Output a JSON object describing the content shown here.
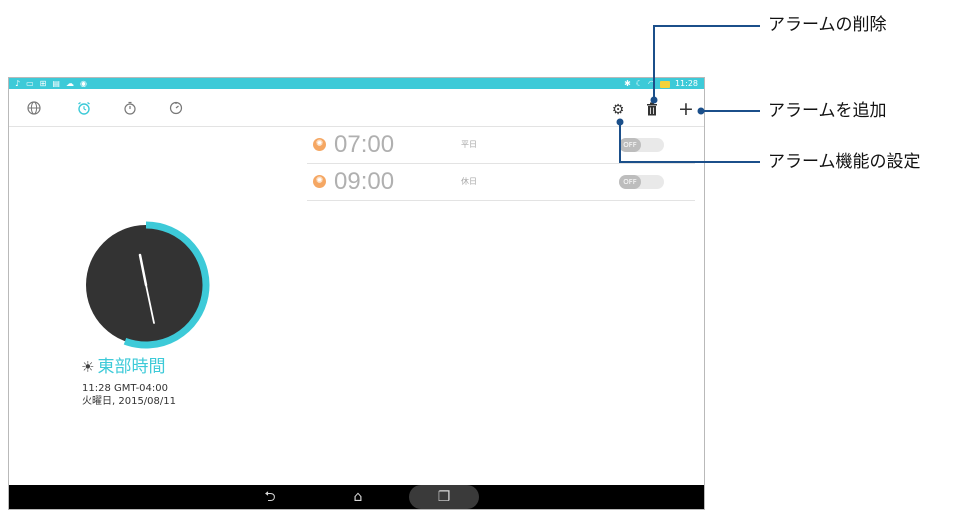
{
  "status_bar": {
    "left_icons": [
      "♪",
      "▭",
      "⊞",
      "▤",
      "☁",
      "◉"
    ],
    "right_icons": [
      "✱",
      "☾",
      "◠"
    ],
    "time": "11:28",
    "color": "#3dcad8"
  },
  "toolbar": {
    "tabs": [
      {
        "icon": "globe-icon",
        "glyph": "🌐"
      },
      {
        "icon": "alarm-icon",
        "glyph": "⏰"
      },
      {
        "icon": "stopwatch-icon",
        "glyph": "⏱"
      },
      {
        "icon": "timer-icon",
        "glyph": "◷"
      }
    ],
    "settings_glyph": "⚙",
    "delete_glyph": "🗑",
    "add_glyph": "+"
  },
  "alarms": [
    {
      "time": "07:00",
      "days": "平日",
      "toggle": "OFF"
    },
    {
      "time": "09:00",
      "days": "休日",
      "toggle": "OFF"
    }
  ],
  "clock": {
    "tz_icon": "☀",
    "tz_name": "東部時間",
    "time_line": "11:28  GMT-04:00",
    "date_line": "火曜日, 2015/08/11",
    "accent_color": "#3dcad8",
    "face_color": "#333333"
  },
  "nav": {
    "back": "⮌",
    "home": "⌂",
    "recent": "❐"
  },
  "callouts": {
    "delete": "アラームの削除",
    "add": "アラームを追加",
    "settings": "アラーム機能の設定"
  }
}
